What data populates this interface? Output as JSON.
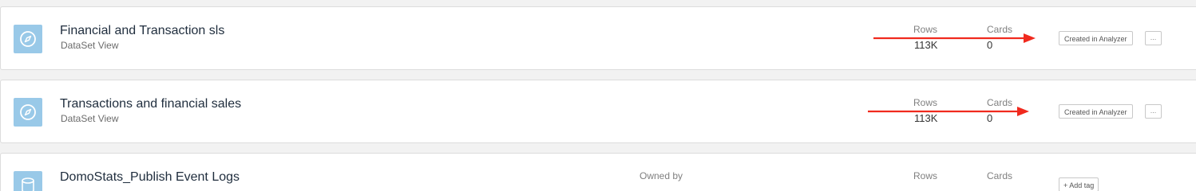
{
  "datasets": [
    {
      "title": "Financial and Transaction sls",
      "subtitle": "DataSet View",
      "icon": "compass-icon",
      "rows_label": "Rows",
      "rows_value": "113K",
      "cards_label": "Cards",
      "cards_value": "0",
      "tag": "Created in Analyzer",
      "more": "..."
    },
    {
      "title": "Transactions and financial sales",
      "subtitle": "DataSet View",
      "icon": "compass-icon",
      "rows_label": "Rows",
      "rows_value": "113K",
      "cards_label": "Cards",
      "cards_value": "0",
      "tag": "Created in Analyzer",
      "more": "..."
    },
    {
      "title": "DomoStats_Publish Event Logs",
      "icon": "database-icon",
      "owned_label": "Owned by",
      "rows_label": "Rows",
      "cards_label": "Cards",
      "add_tag": "+ Add tag"
    }
  ],
  "colors": {
    "icon_bg": "#99c9e8",
    "annotation_arrow": "#f02a1e"
  }
}
